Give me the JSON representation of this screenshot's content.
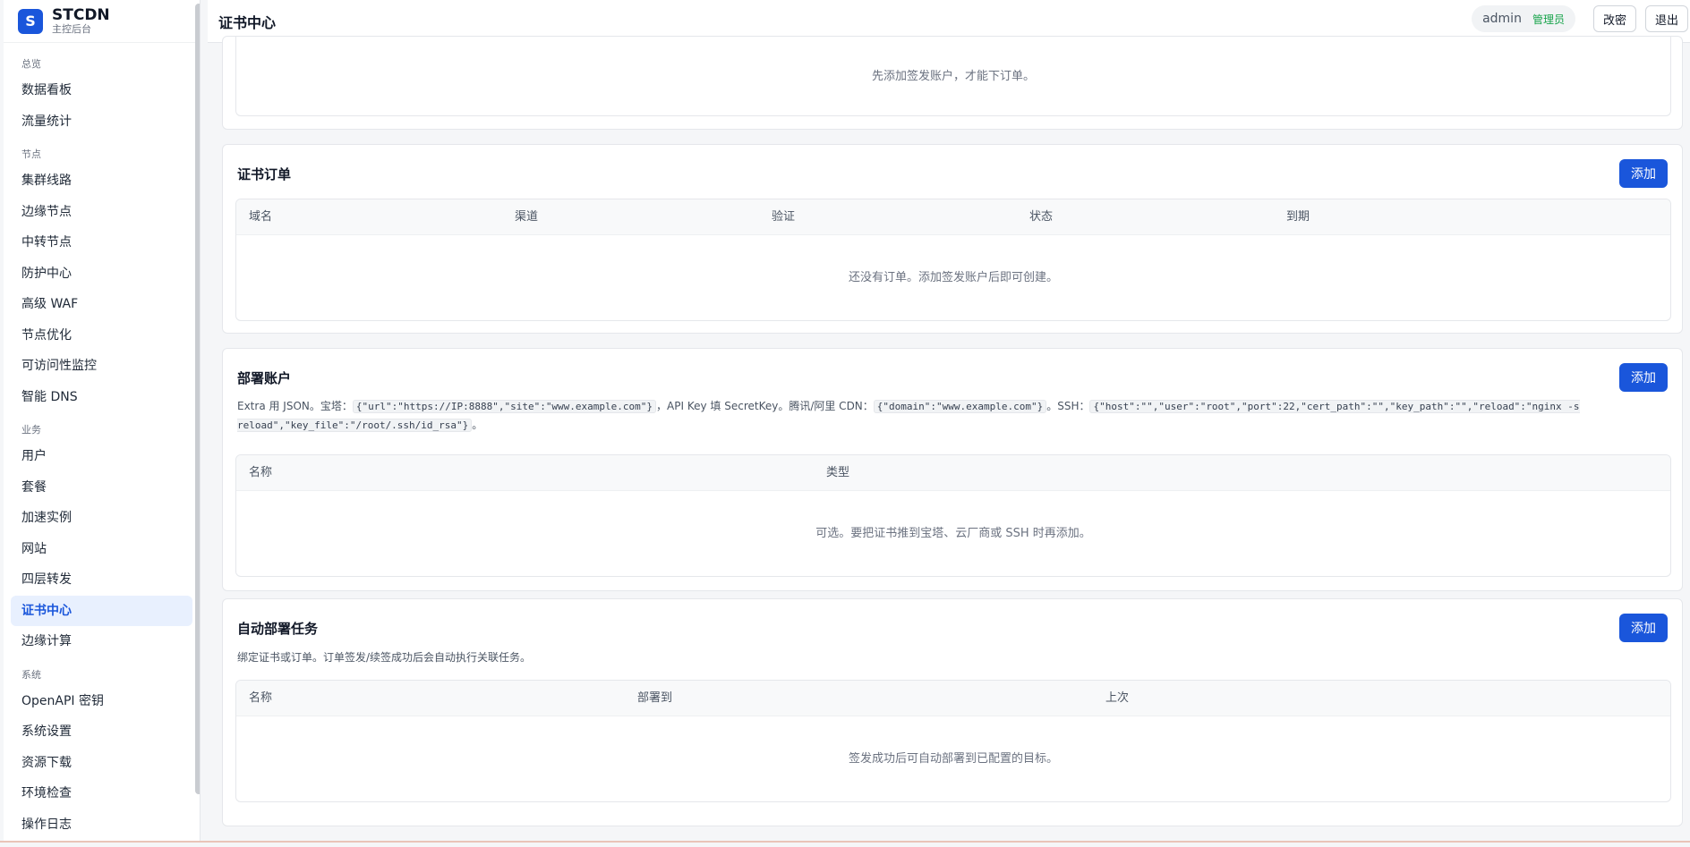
{
  "brand": {
    "logo": "S",
    "name": "STCDN",
    "subtitle": "主控后台"
  },
  "nav": {
    "groups": [
      {
        "label": "总览",
        "items": [
          "数据看板",
          "流量统计"
        ]
      },
      {
        "label": "节点",
        "items": [
          "集群线路",
          "边缘节点",
          "中转节点",
          "防护中心",
          "高级 WAF",
          "节点优化",
          "可访问性监控",
          "智能 DNS"
        ]
      },
      {
        "label": "业务",
        "items": [
          "用户",
          "套餐",
          "加速实例",
          "网站",
          "四层转发",
          "证书中心",
          "边缘计算"
        ]
      },
      {
        "label": "系统",
        "items": [
          "OpenAPI 密钥",
          "系统设置",
          "资源下载",
          "环境检查",
          "操作日志"
        ]
      }
    ],
    "active": "证书中心"
  },
  "header": {
    "title": "证书中心",
    "user": "admin",
    "role": "管理员",
    "change_password": "改密",
    "logout": "退出"
  },
  "sections": {
    "issuer": {
      "empty": "先添加签发账户，才能下订单。"
    },
    "orders": {
      "title": "证书订单",
      "add": "添加",
      "columns": [
        "域名",
        "渠道",
        "验证",
        "状态",
        "到期"
      ],
      "empty": "还没有订单。添加签发账户后即可创建。"
    },
    "deploy_accounts": {
      "title": "部署账户",
      "add": "添加",
      "desc": {
        "p1": "Extra 用 JSON。宝塔：",
        "c1": "{\"url\":\"https://IP:8888\",\"site\":\"www.example.com\"}",
        "p2": "，API Key 填 SecretKey。腾讯/阿里 CDN：",
        "c2": "{\"domain\":\"www.example.com\"}",
        "p3": "。SSH：",
        "c3": "{\"host\":\"\",\"user\":\"root\",\"port\":22,\"cert_path\":\"\",\"key_path\":\"\",\"reload\":\"nginx -s reload\",\"key_file\":\"/root/.ssh/id_rsa\"}",
        "p4": "。"
      },
      "columns": [
        "名称",
        "类型"
      ],
      "empty": "可选。要把证书推到宝塔、云厂商或 SSH 时再添加。"
    },
    "auto_deploy": {
      "title": "自动部署任务",
      "add": "添加",
      "desc": "绑定证书或订单。订单签发/续签成功后会自动执行关联任务。",
      "columns": [
        "名称",
        "部署到",
        "上次"
      ],
      "empty": "签发成功后可自动部署到已配置的目标。"
    }
  },
  "colors": {
    "accent": "#1a56db",
    "role": "#16a34a"
  }
}
